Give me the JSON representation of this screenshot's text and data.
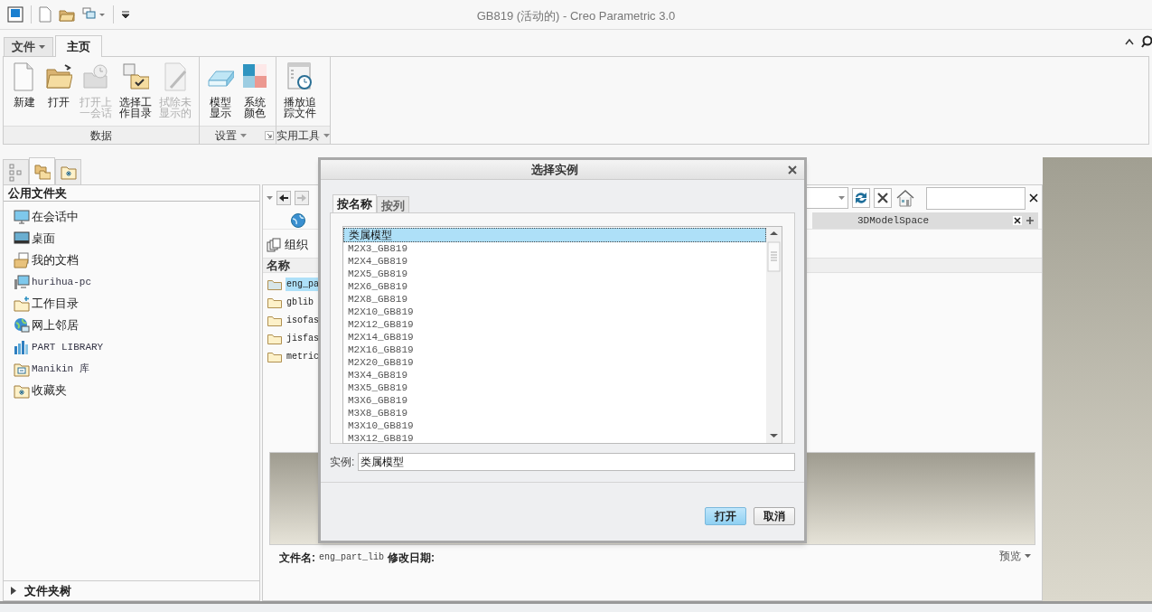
{
  "window": {
    "title": "GB819 (活动的) - Creo Parametric 3.0"
  },
  "ribbon_tabs": [
    {
      "label": "文件",
      "kind": "menu",
      "selected": false
    },
    {
      "label": "主页",
      "kind": "tab",
      "selected": true
    }
  ],
  "ribbon_groups": [
    {
      "label": "数据",
      "dropdown": false,
      "launcher": false,
      "buttons": [
        {
          "label": "新建",
          "disabled": false
        },
        {
          "label": "打开",
          "disabled": false
        },
        {
          "label": "打开上一会话",
          "disabled": true
        },
        {
          "label": "选择工作目录",
          "disabled": false
        },
        {
          "label": "拭除未显示的",
          "disabled": true
        }
      ]
    },
    {
      "label": "设置",
      "dropdown": true,
      "launcher": true,
      "buttons": [
        {
          "label": "模型显示",
          "disabled": false
        },
        {
          "label": "系统颜色",
          "disabled": false
        }
      ]
    },
    {
      "label": "实用工具",
      "dropdown": true,
      "launcher": false,
      "buttons": [
        {
          "label": "播放追踪文件",
          "disabled": false
        }
      ]
    }
  ],
  "navigator": {
    "tabs": [
      {
        "selected": false
      },
      {
        "selected": true
      },
      {
        "selected": false
      }
    ],
    "header": "公用文件夹",
    "items": [
      {
        "label": "在会话中",
        "kind": "cjk"
      },
      {
        "label": "桌面",
        "kind": "cjk"
      },
      {
        "label": "我的文档",
        "kind": "cjk"
      },
      {
        "label": "hurihua-pc",
        "kind": "latin"
      },
      {
        "label": "工作目录",
        "kind": "cjk"
      },
      {
        "label": "网上邻居",
        "kind": "cjk"
      },
      {
        "label": "PART LIBRARY",
        "kind": "latin"
      },
      {
        "label": "Manikin 库",
        "kind": "latin"
      },
      {
        "label": "收藏夹",
        "kind": "cjk"
      }
    ],
    "folder_tree": {
      "label": "文件夹树",
      "expanded": false
    }
  },
  "browser": {
    "tab": {
      "label": "3DModelSpace"
    },
    "toolbar": {
      "organize": "组织"
    },
    "column": "名称",
    "files": [
      {
        "name": "eng_pa",
        "selected": true
      },
      {
        "name": "gblib",
        "selected": false
      },
      {
        "name": "isofas",
        "selected": false
      },
      {
        "name": "jisfas",
        "selected": false
      },
      {
        "name": "metric",
        "selected": false
      }
    ],
    "details": {
      "file_label": "文件名:",
      "file_value": "eng_part_lib",
      "date_label": "修改日期:"
    },
    "preview": "预览"
  },
  "dialog": {
    "title": "选择实例",
    "tabs": [
      {
        "label": "按名称",
        "selected": true
      },
      {
        "label": "按列",
        "selected": false
      }
    ],
    "instances": [
      {
        "label": "类属模型",
        "selected": true
      },
      {
        "label": "M2X3_GB819",
        "selected": false
      },
      {
        "label": "M2X4_GB819",
        "selected": false
      },
      {
        "label": "M2X5_GB819",
        "selected": false
      },
      {
        "label": "M2X6_GB819",
        "selected": false
      },
      {
        "label": "M2X8_GB819",
        "selected": false
      },
      {
        "label": "M2X10_GB819",
        "selected": false
      },
      {
        "label": "M2X12_GB819",
        "selected": false
      },
      {
        "label": "M2X14_GB819",
        "selected": false
      },
      {
        "label": "M2X16_GB819",
        "selected": false
      },
      {
        "label": "M2X20_GB819",
        "selected": false
      },
      {
        "label": "M3X4_GB819",
        "selected": false
      },
      {
        "label": "M3X5_GB819",
        "selected": false
      },
      {
        "label": "M3X6_GB819",
        "selected": false
      },
      {
        "label": "M3X8_GB819",
        "selected": false
      },
      {
        "label": "M3X10_GB819",
        "selected": false
      },
      {
        "label": "M3X12_GB819",
        "selected": false
      }
    ],
    "instance_label": "实例:",
    "instance_value": "类属模型",
    "buttons": [
      {
        "label": "打开",
        "primary": true
      },
      {
        "label": "取消",
        "primary": false
      }
    ]
  }
}
